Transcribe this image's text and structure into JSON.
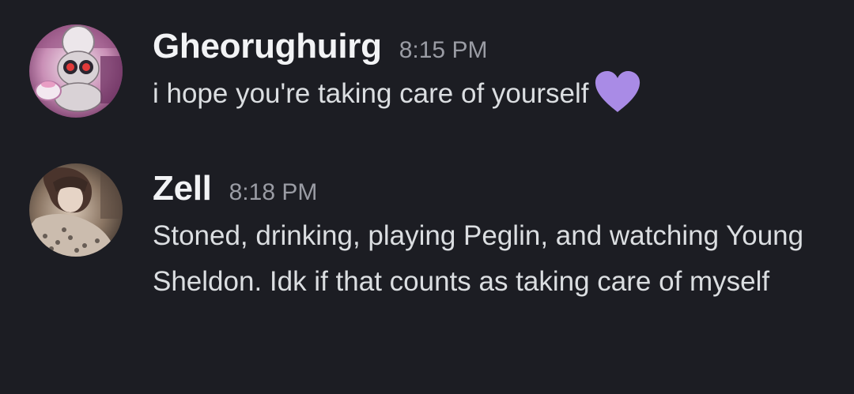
{
  "messages": [
    {
      "username": "Gheorughuirg",
      "timestamp": "8:15 PM",
      "text": "i hope you're taking care of yourself",
      "emoji": "purple-heart",
      "avatar": "pokemon-avatar"
    },
    {
      "username": "Zell",
      "timestamp": "8:18 PM",
      "text": "Stoned, drinking, playing Peglin, and watching Young Sheldon. Idk if that counts as taking care of myself",
      "avatar": "photo-avatar"
    }
  ],
  "colors": {
    "background": "#1c1d23",
    "username": "#f2f3f5",
    "timestamp": "#9a9ca4",
    "message_text": "#dbdee1",
    "heart": "#a98be6"
  }
}
